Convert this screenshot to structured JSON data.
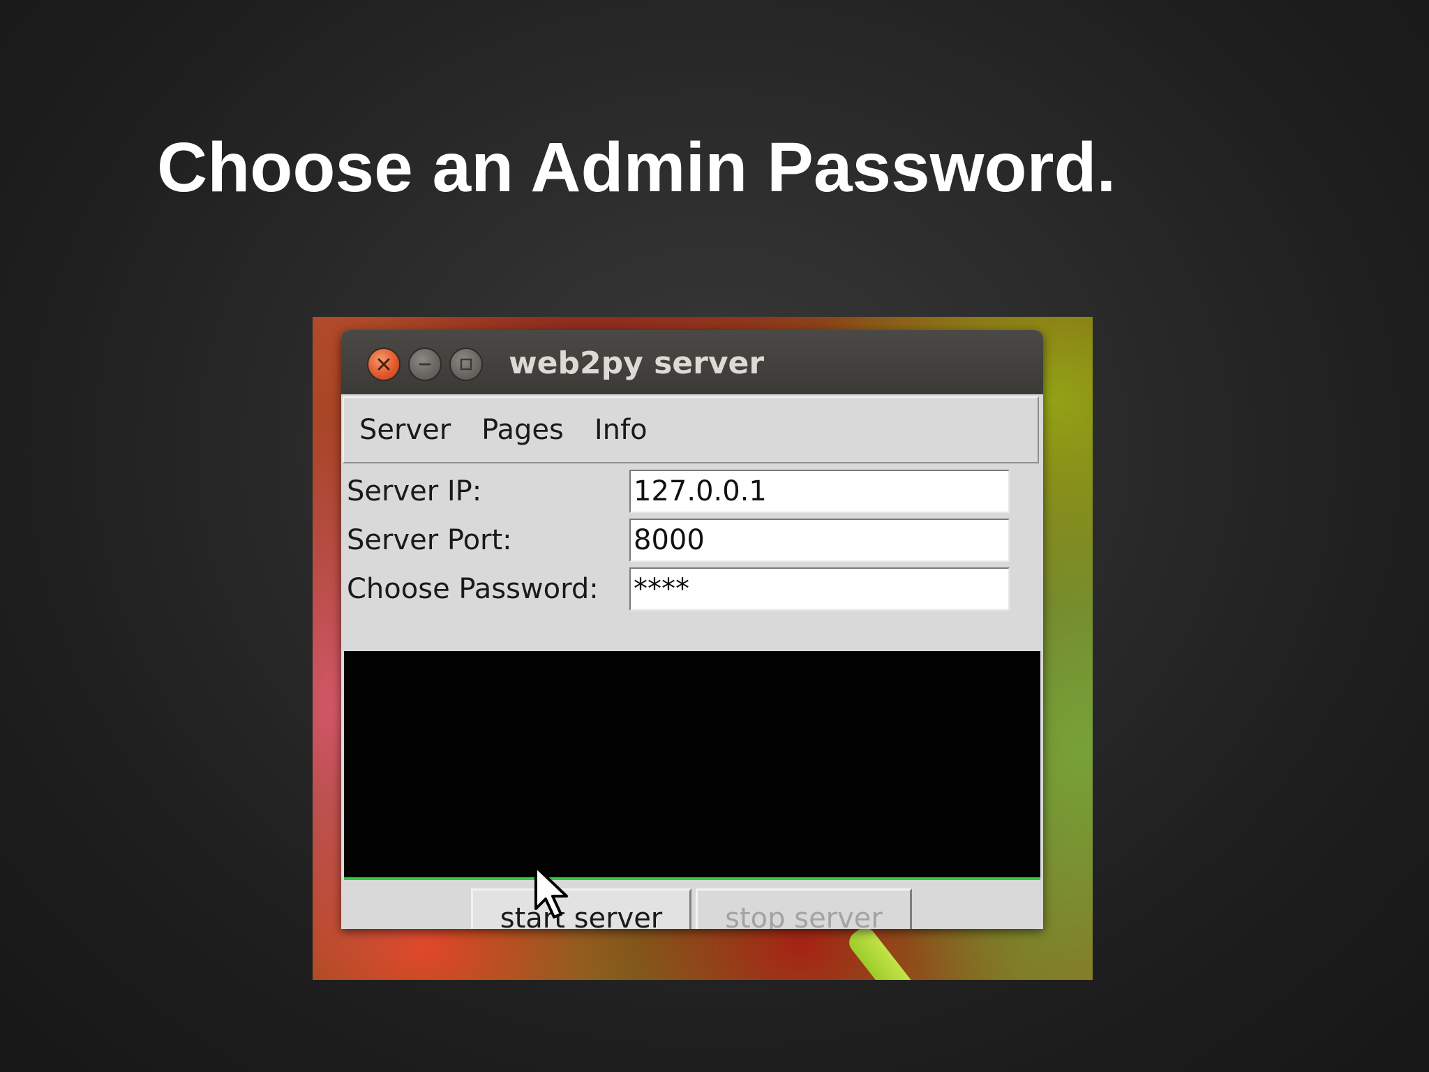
{
  "slide": {
    "title": "Choose an Admin Password."
  },
  "window": {
    "title": "web2py server",
    "controls": {
      "close_icon": "close-icon",
      "minimize_icon": "minimize-icon",
      "maximize_icon": "maximize-icon"
    }
  },
  "menu": {
    "items": [
      "Server",
      "Pages",
      "Info"
    ]
  },
  "form": {
    "server_ip_label": "Server IP:",
    "server_ip_value": "127.0.0.1",
    "server_port_label": "Server Port:",
    "server_port_value": "8000",
    "password_label": "Choose Password:",
    "password_value": "****"
  },
  "buttons": {
    "start_label": "start server",
    "stop_label": "stop server",
    "stop_enabled": false
  },
  "colors": {
    "console_background": "#020203",
    "console_status_line": "#2ecc40",
    "close_button": "#e0552a",
    "disabled_text": "#a3a3a3"
  }
}
